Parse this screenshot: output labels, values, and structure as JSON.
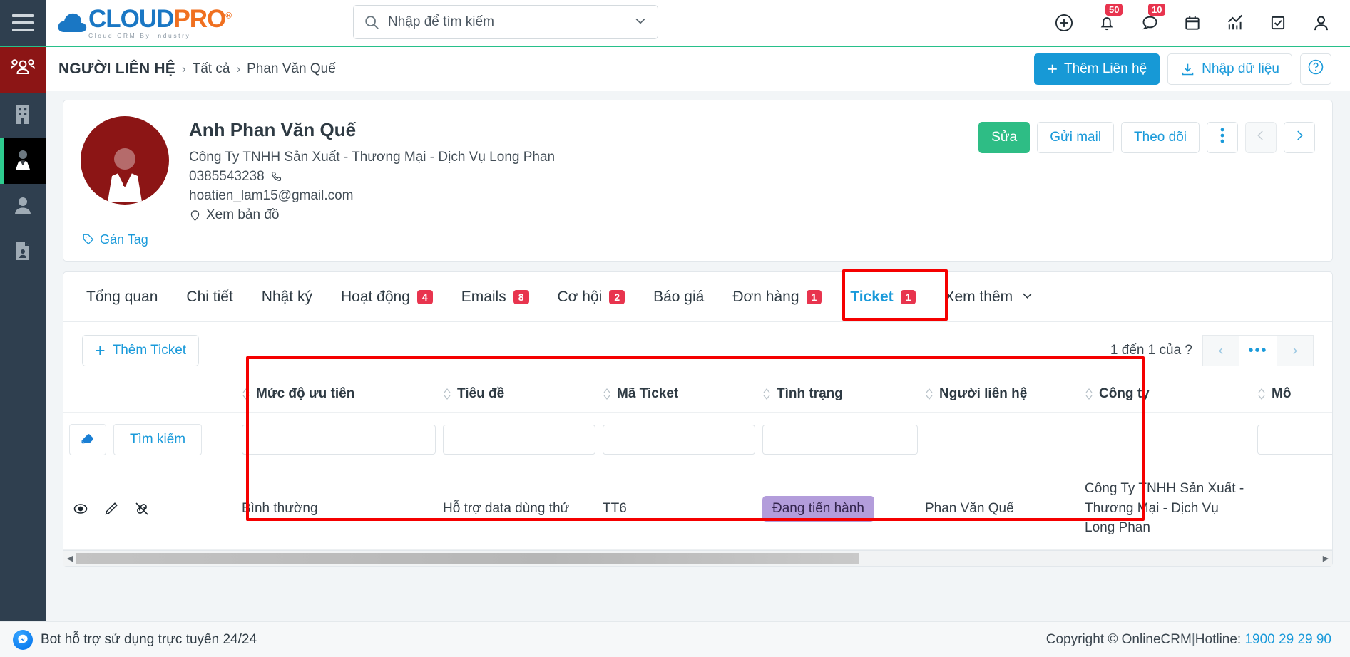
{
  "brand": {
    "name_cloud": "CLOUD",
    "name_pro": "PRO",
    "reg": "®",
    "tagline": "Cloud CRM By Industry",
    "accent": "#1799d6",
    "accent_orange": "#f07020"
  },
  "search": {
    "placeholder": "Nhập để tìm kiếm",
    "value": ""
  },
  "topbar": {
    "icons": [
      {
        "name": "add-circle-icon",
        "badge": null
      },
      {
        "name": "bell-icon",
        "badge": "50"
      },
      {
        "name": "chat-icon",
        "badge": "10"
      },
      {
        "name": "calendar-icon",
        "badge": null
      },
      {
        "name": "analytics-icon",
        "badge": null
      },
      {
        "name": "task-check-icon",
        "badge": null
      },
      {
        "name": "user-account-icon",
        "badge": null
      }
    ]
  },
  "sidebar": {
    "items": [
      {
        "name": "sidebar-item-group",
        "icon": "people-group-icon",
        "state": "red"
      },
      {
        "name": "sidebar-item-company",
        "icon": "building-icon",
        "state": "normal"
      },
      {
        "name": "sidebar-item-contact",
        "icon": "contact-person-icon",
        "state": "active"
      },
      {
        "name": "sidebar-item-lead",
        "icon": "person-icon",
        "state": "normal"
      },
      {
        "name": "sidebar-item-document",
        "icon": "document-person-icon",
        "state": "normal"
      }
    ]
  },
  "breadcrumb": {
    "module": "NGƯỜI LIÊN HỆ",
    "sep": "›",
    "all": "Tất cả",
    "current": "Phan Văn Quế"
  },
  "page_actions": {
    "add_contact": "Thêm Liên hệ",
    "import": "Nhập dữ liệu",
    "help": "?"
  },
  "contact": {
    "name": "Anh Phan Văn Quế",
    "company": "Công Ty TNHH Sản Xuất - Thương Mại - Dịch Vụ Long Phan",
    "phone": "0385543238",
    "email": "hoatien_lam15@gmail.com",
    "map_link": "Xem bản đồ",
    "tag_link": "Gán Tag",
    "avatar_color": "#8c1515",
    "actions": {
      "edit": "Sửa",
      "send_mail": "Gửi mail",
      "follow": "Theo dõi",
      "more": "⋮",
      "prev": "‹",
      "next": "›"
    }
  },
  "tabs": [
    {
      "label": "Tổng quan",
      "count": null,
      "active": false
    },
    {
      "label": "Chi tiết",
      "count": null,
      "active": false
    },
    {
      "label": "Nhật ký",
      "count": null,
      "active": false
    },
    {
      "label": "Hoạt động",
      "count": "4",
      "active": false
    },
    {
      "label": "Emails",
      "count": "8",
      "active": false
    },
    {
      "label": "Cơ hội",
      "count": "2",
      "active": false
    },
    {
      "label": "Báo giá",
      "count": null,
      "active": false
    },
    {
      "label": "Đơn hàng",
      "count": "1",
      "active": false
    },
    {
      "label": "Ticket",
      "count": "1",
      "active": true
    },
    {
      "label": "Xem thêm",
      "count": null,
      "active": false,
      "chevron": true
    }
  ],
  "ticket_panel": {
    "add_button": "Thêm Ticket",
    "pager_text": "1 đến 1 của  ?",
    "pager_prev": "‹",
    "pager_more": "•••",
    "pager_next": "›",
    "search_button": "Tìm kiếm",
    "eraser_icon": "eraser-icon"
  },
  "table": {
    "columns": [
      {
        "key": "priority",
        "label": "Mức độ ưu tiên",
        "sortable": true,
        "filterable": true
      },
      {
        "key": "title",
        "label": "Tiêu đề",
        "sortable": true,
        "filterable": true
      },
      {
        "key": "code",
        "label": "Mã Ticket",
        "sortable": true,
        "filterable": true
      },
      {
        "key": "status",
        "label": "Tình trạng",
        "sortable": true,
        "filterable": true
      },
      {
        "key": "contact",
        "label": "Người liên hệ",
        "sortable": true,
        "filterable": false
      },
      {
        "key": "company",
        "label": "Công ty",
        "sortable": true,
        "filterable": false
      },
      {
        "key": "desc",
        "label": "Mô",
        "sortable": true,
        "filterable": true
      }
    ],
    "filters": {
      "priority": "",
      "title": "",
      "code": "",
      "status": "",
      "desc": ""
    },
    "rows": [
      {
        "priority": "Bình thường",
        "title": "Hỗ trợ data dùng thử",
        "code": "TT6",
        "status": "Đang tiến hành",
        "status_color": "#b39ddb",
        "contact": "Phan Văn Quế",
        "company": "Công Ty TNHH Sản Xuất - Thương Mại - Dịch Vụ Long Phan",
        "desc": ""
      }
    ],
    "row_icons": [
      "eye-icon",
      "pencil-icon",
      "unlink-icon"
    ]
  },
  "footer": {
    "bot_text": "Bot hỗ trợ sử dụng trực tuyến 24/24",
    "copyright": "Copyright © OnlineCRM",
    "divider": "|",
    "hotline_label": "Hotline:",
    "hotline_number": "1900 29 29 90"
  }
}
